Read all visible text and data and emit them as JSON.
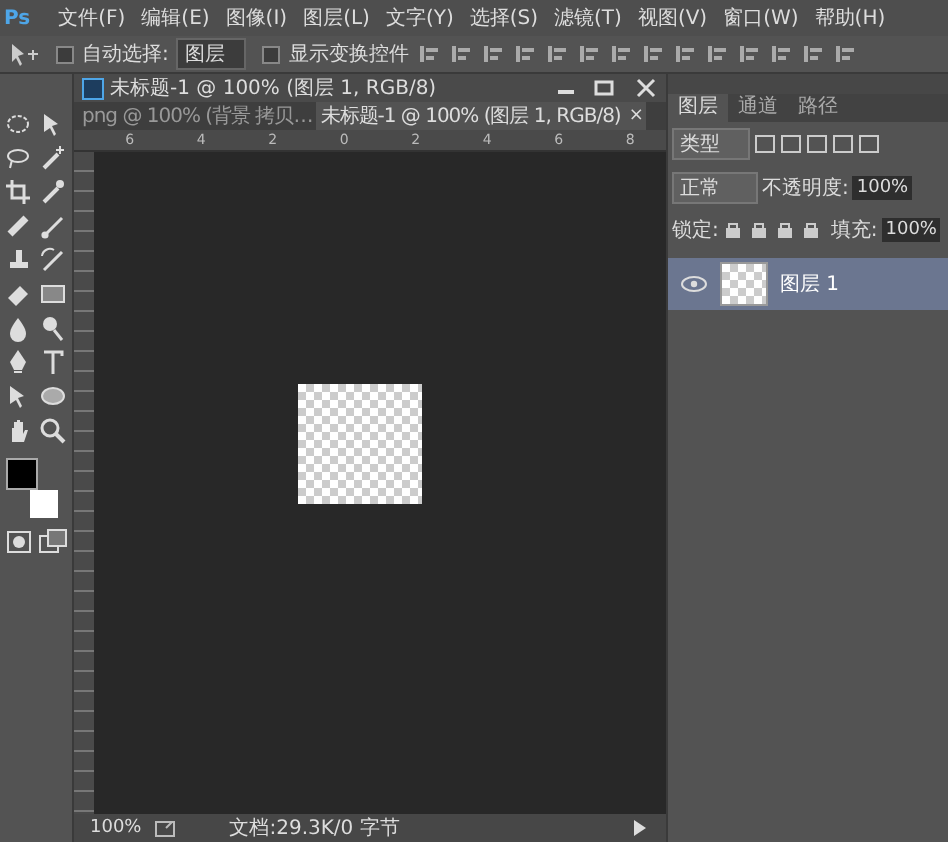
{
  "menu": {
    "logo": "Ps",
    "items": [
      "文件(F)",
      "编辑(E)",
      "图像(I)",
      "图层(L)",
      "文字(Y)",
      "选择(S)",
      "滤镜(T)",
      "视图(V)",
      "窗口(W)",
      "帮助(H)"
    ]
  },
  "options": {
    "auto_select_label": "自动选择:",
    "auto_select_checked": false,
    "auto_select_target": "图层",
    "show_transform_label": "显示变换控件",
    "show_transform_checked": false
  },
  "document": {
    "title": "未标题-1 @ 100% (图层 1, RGB/8)",
    "tabs": [
      {
        "label": "png @ 100% (背景 拷贝…",
        "selected": false
      },
      {
        "label": "未标题-1 @ 100% (图层 1, RGB/8)",
        "selected": true,
        "close": "×"
      }
    ],
    "ruler_labels": [
      "6",
      "4",
      "2",
      "0",
      "2",
      "4",
      "6",
      "8"
    ],
    "zoom": "100%",
    "doc_info": "文档:29.3K/0 字节"
  },
  "panel": {
    "tabs": [
      {
        "label": "图层",
        "selected": true
      },
      {
        "label": "通道",
        "selected": false
      },
      {
        "label": "路径",
        "selected": false
      }
    ],
    "filter": "类型",
    "blend_mode": "正常",
    "opacity_label": "不透明度:",
    "opacity": "100%",
    "lock_label": "锁定:",
    "fill_label": "填充:",
    "fill": "100%",
    "layers": [
      {
        "name": "图层 1",
        "visible": true,
        "selected": true
      }
    ]
  }
}
